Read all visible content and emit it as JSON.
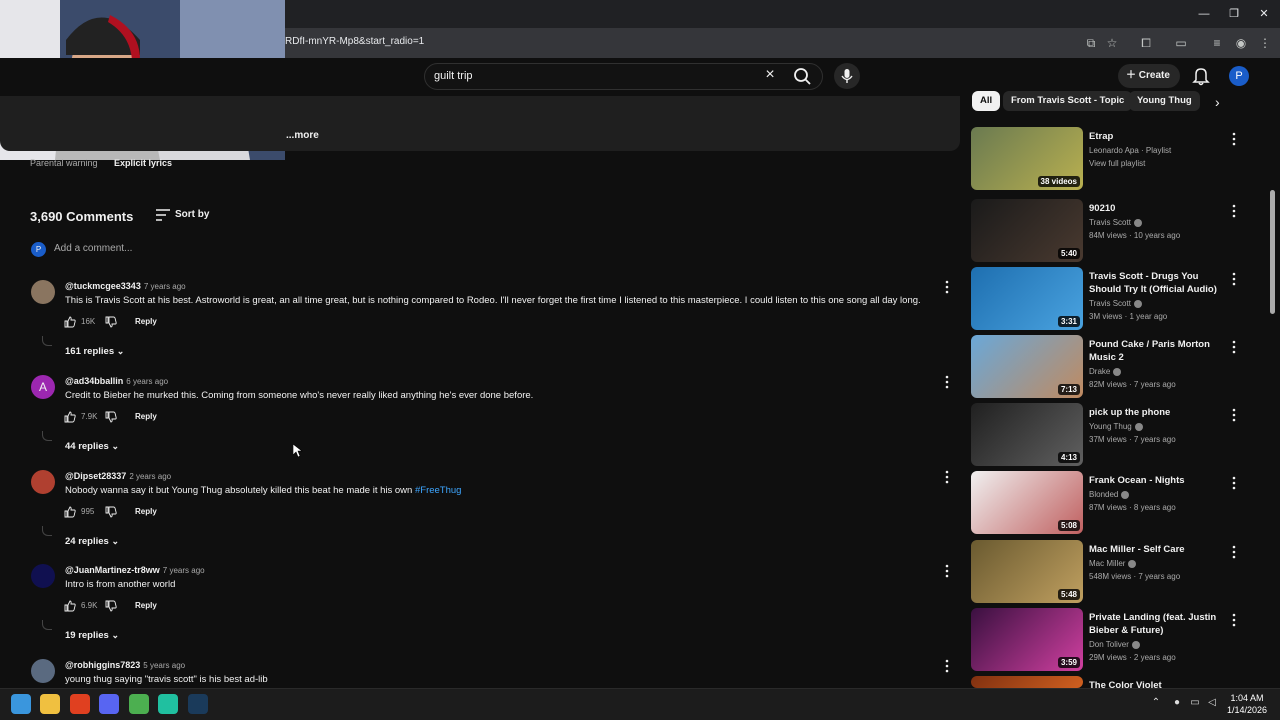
{
  "browser": {
    "url": "RDfI-mnYR-Mp8&start_radio=1",
    "window_controls": [
      "minimize-icon",
      "restore-icon",
      "close-icon"
    ]
  },
  "header": {
    "search_query": "guilt trip",
    "create_label": "Create",
    "avatar_letter": "P"
  },
  "description": {
    "more_label": "...more",
    "parental_warning_label": "Parental warning",
    "parental_warning_value": "Explicit lyrics"
  },
  "comments_section": {
    "count_label": "3,690 Comments",
    "sort_label": "Sort by",
    "my_avatar_letter": "P",
    "add_placeholder": "Add a comment...",
    "comments": [
      {
        "user": "@tuckmcgee3343",
        "time": "7 years ago",
        "text": "This is Travis Scott at his best. Astroworld is great, an all time great, but is nothing compared to Rodeo. I'll never forget the first time I listened to this masterpiece. I could listen to this one song all day long.",
        "likes": "16K",
        "reply_label": "Reply",
        "replies": "161 replies",
        "avatar_color": "#8a7560"
      },
      {
        "user": "@ad34bballin",
        "time": "6 years ago",
        "text": "Credit to Bieber he murked this. Coming from someone who's never really liked anything he's ever done before.",
        "likes": "7.9K",
        "reply_label": "Reply",
        "replies": "44 replies",
        "avatar_letter": "A",
        "avatar_color": "#9c27b0"
      },
      {
        "user": "@Dipset28337",
        "time": "2 years ago",
        "text": "Nobody wanna say it but Young Thug absolutely killed this beat he made it his own",
        "hashtag": "#FreeThug",
        "likes": "995",
        "reply_label": "Reply",
        "replies": "24 replies",
        "avatar_color": "#b04030"
      },
      {
        "user": "@JuanMartinez-tr8ww",
        "time": "7 years ago",
        "text": "Intro is from another world",
        "likes": "6.9K",
        "reply_label": "Reply",
        "replies": "19 replies",
        "avatar_color": "#101050"
      },
      {
        "user": "@robhiggins7823",
        "time": "5 years ago",
        "text": "young thug saying \"travis scott\" is his best ad-lib",
        "avatar_color": "#5a6a80"
      }
    ]
  },
  "chips": [
    "All",
    "From Travis Scott - Topic",
    "Young Thug"
  ],
  "side_videos": [
    {
      "title": "Etrap",
      "meta1": "Leonardo Apa · Playlist",
      "meta2": "View full playlist",
      "duration": "38 videos",
      "colors": [
        "#6a7a50",
        "#b9b050"
      ]
    },
    {
      "title": "90210",
      "meta1": "Travis Scott",
      "verified": true,
      "meta2": "84M views · 10 years ago",
      "duration": "5:40",
      "colors": [
        "#1a1a1a",
        "#4a3a30"
      ]
    },
    {
      "title": "Travis Scott - Drugs You Should Try It (Official Audio)",
      "meta1": "Travis Scott",
      "verified": true,
      "meta2": "3M views · 1 year ago",
      "duration": "3:31",
      "colors": [
        "#1e6fb0",
        "#4aa3e0"
      ]
    },
    {
      "title": "Pound Cake / Paris Morton Music 2",
      "meta1": "Drake",
      "verified": true,
      "meta2": "82M views · 7 years ago",
      "duration": "7:13",
      "colors": [
        "#6aa8d8",
        "#c08a60"
      ]
    },
    {
      "title": "pick up the phone",
      "meta1": "Young Thug",
      "verified": true,
      "meta2": "37M views · 7 years ago",
      "duration": "4:13",
      "colors": [
        "#202020",
        "#606060"
      ]
    },
    {
      "title": "Frank Ocean - Nights",
      "meta1": "Blonded",
      "verified": true,
      "meta2": "87M views · 8 years ago",
      "duration": "5:08",
      "colors": [
        "#f0f0f0",
        "#c06060"
      ]
    },
    {
      "title": "Mac Miller - Self Care",
      "meta1": "Mac Miller",
      "verified": true,
      "meta2": "548M views · 7 years ago",
      "duration": "5:48",
      "colors": [
        "#6a5a30",
        "#c0a060"
      ]
    },
    {
      "title": "Private Landing (feat. Justin Bieber & Future)",
      "meta1": "Don Toliver",
      "verified": true,
      "meta2": "29M views · 2 years ago",
      "duration": "3:59",
      "colors": [
        "#3a1040",
        "#d040a0"
      ]
    },
    {
      "title": "The Color Violet",
      "meta1": "",
      "meta2": "",
      "duration": "",
      "colors": [
        "#803010",
        "#d06020"
      ]
    }
  ],
  "taskbar": {
    "apps": [
      {
        "name": "windows-start-icon",
        "color": "#3a96dd"
      },
      {
        "name": "file-explorer-icon",
        "color": "#f0c040"
      },
      {
        "name": "brave-icon",
        "color": "#e04020"
      },
      {
        "name": "discord-icon",
        "color": "#5865f2"
      },
      {
        "name": "chrome-icon",
        "color": "#4caf50"
      },
      {
        "name": "app-icon",
        "color": "#20c0a0"
      },
      {
        "name": "steam-icon",
        "color": "#1a3a5a"
      }
    ],
    "time": "1:04 AM",
    "date": "1/14/2026"
  }
}
